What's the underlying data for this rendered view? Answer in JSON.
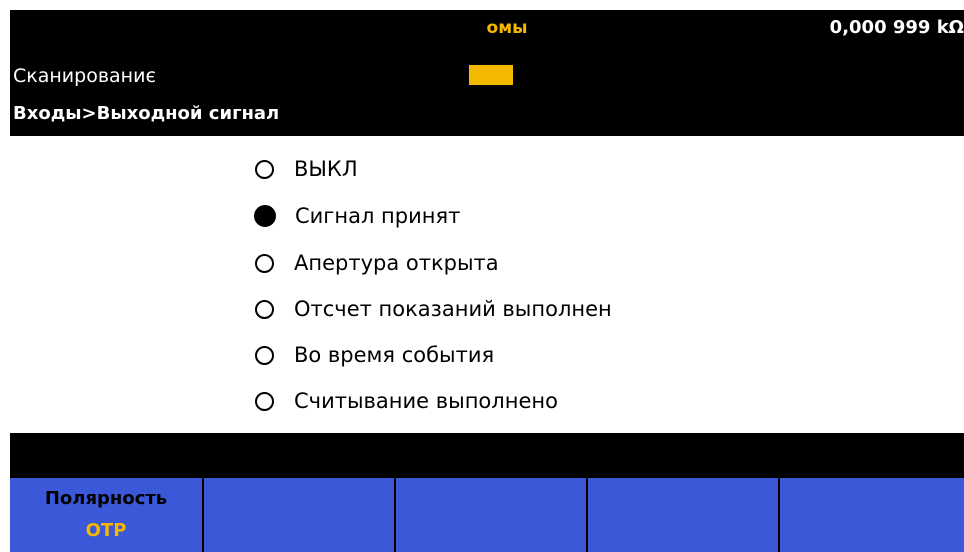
{
  "status": {
    "mode": "омы",
    "reading": "0,000 999 kΩ"
  },
  "header": {
    "scan_label": "Сканированиє",
    "scan_indicator_color": "#f5b800",
    "breadcrumb": "Входы>Выходной сигнал"
  },
  "options": [
    {
      "label": "ВЫКЛ",
      "selected": false
    },
    {
      "label": "Сигнал принят",
      "selected": true
    },
    {
      "label": "Апертура открыта",
      "selected": false
    },
    {
      "label": "Отсчет показаний выполнен",
      "selected": false
    },
    {
      "label": "Во время события",
      "selected": false
    },
    {
      "label": "Считывание выполнено",
      "selected": false
    }
  ],
  "softkeys": [
    {
      "title": "Полярность",
      "value": "ОТР"
    },
    {
      "title": "",
      "value": ""
    },
    {
      "title": "",
      "value": ""
    },
    {
      "title": "",
      "value": ""
    },
    {
      "title": "",
      "value": ""
    }
  ],
  "colors": {
    "accent": "#f5b800",
    "softkey": "#3a58d8",
    "background": "#000000"
  }
}
